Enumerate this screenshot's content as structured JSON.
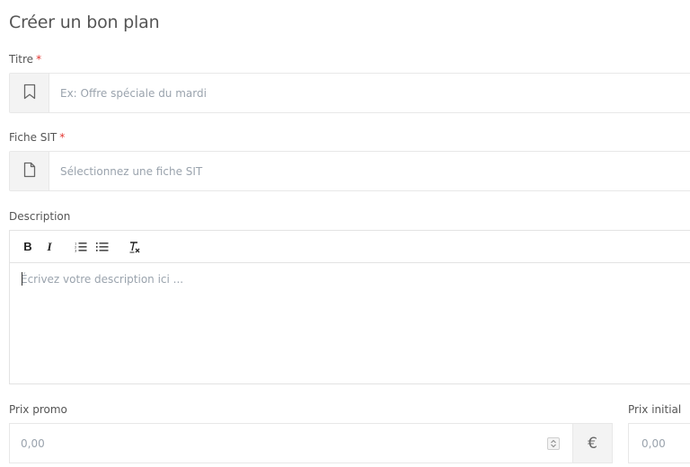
{
  "page": {
    "title": "Créer un bon plan"
  },
  "form": {
    "titre": {
      "label": "Titre",
      "required_marker": "*",
      "placeholder": "Ex: Offre spéciale du mardi",
      "icon": "bookmark-icon"
    },
    "fiche_sit": {
      "label": "Fiche SIT",
      "required_marker": "*",
      "placeholder": "Sélectionnez une fiche SIT",
      "icon": "file-icon"
    },
    "description": {
      "label": "Description",
      "placeholder": "Écrivez votre description ici ...",
      "toolbar": {
        "bold": "B",
        "italic": "I",
        "ordered_list": "ordered-list-icon",
        "unordered_list": "unordered-list-icon",
        "clear_format": "clear-format-icon"
      }
    },
    "prix_promo": {
      "label": "Prix promo",
      "placeholder": "0,00",
      "currency": "€"
    },
    "prix_initial": {
      "label": "Prix initial",
      "placeholder": "0,00"
    }
  },
  "colors": {
    "required": "#e3342f",
    "addon_bg": "#f3f3f3",
    "border": "#e8e8e8",
    "placeholder": "#9aa3ad"
  }
}
